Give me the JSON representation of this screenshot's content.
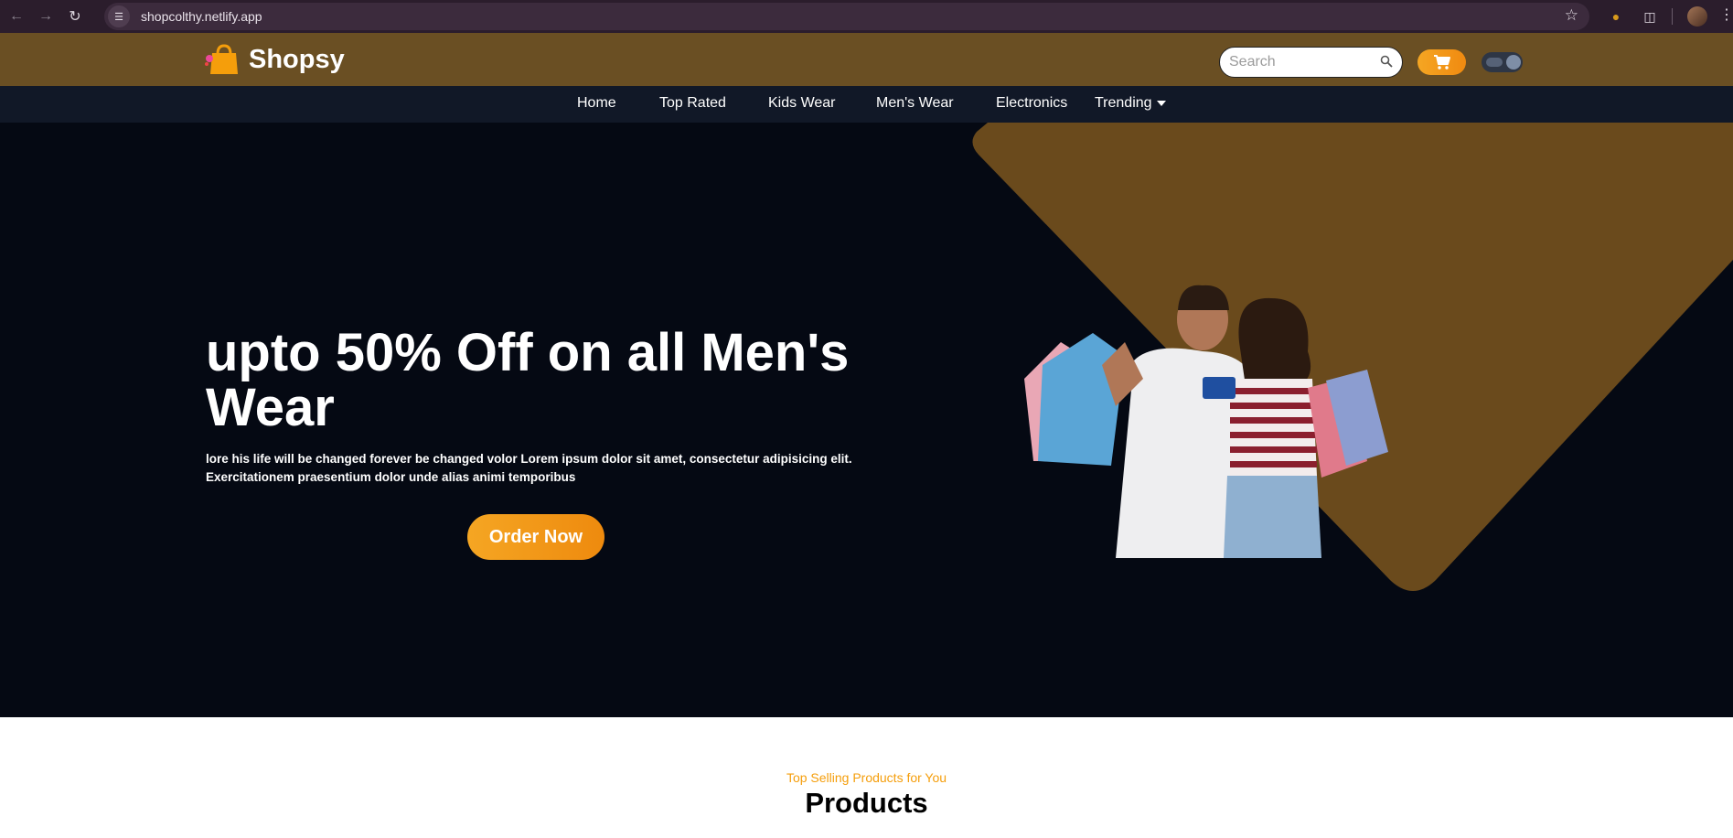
{
  "browser": {
    "url": "shopcolthy.netlify.app",
    "back_icon": "arrow-left-icon",
    "forward_icon": "arrow-right-icon",
    "reload_icon": "reload-icon"
  },
  "header": {
    "logo_text": "Shopsy",
    "search_placeholder": "Search",
    "accent_color": "#f5a623",
    "header_color": "#6a4f23"
  },
  "nav": {
    "items": [
      {
        "label": "Home"
      },
      {
        "label": "Top Rated"
      },
      {
        "label": "Kids Wear"
      },
      {
        "label": "Men's Wear"
      },
      {
        "label": "Electronics"
      },
      {
        "label": "Trending"
      }
    ]
  },
  "hero": {
    "title": "upto 50% Off on all Men's Wear",
    "description": "lore his life will be changed forever be changed volor Lorem ipsum dolor sit amet, consectetur adipisicing elit. Exercitationem praesentium dolor unde alias animi temporibus",
    "cta_label": "Order Now",
    "background_color": "#050913",
    "shape_color": "#6a4a1c"
  },
  "products": {
    "subtitle": "Top Selling Products for You",
    "title": "Products"
  }
}
